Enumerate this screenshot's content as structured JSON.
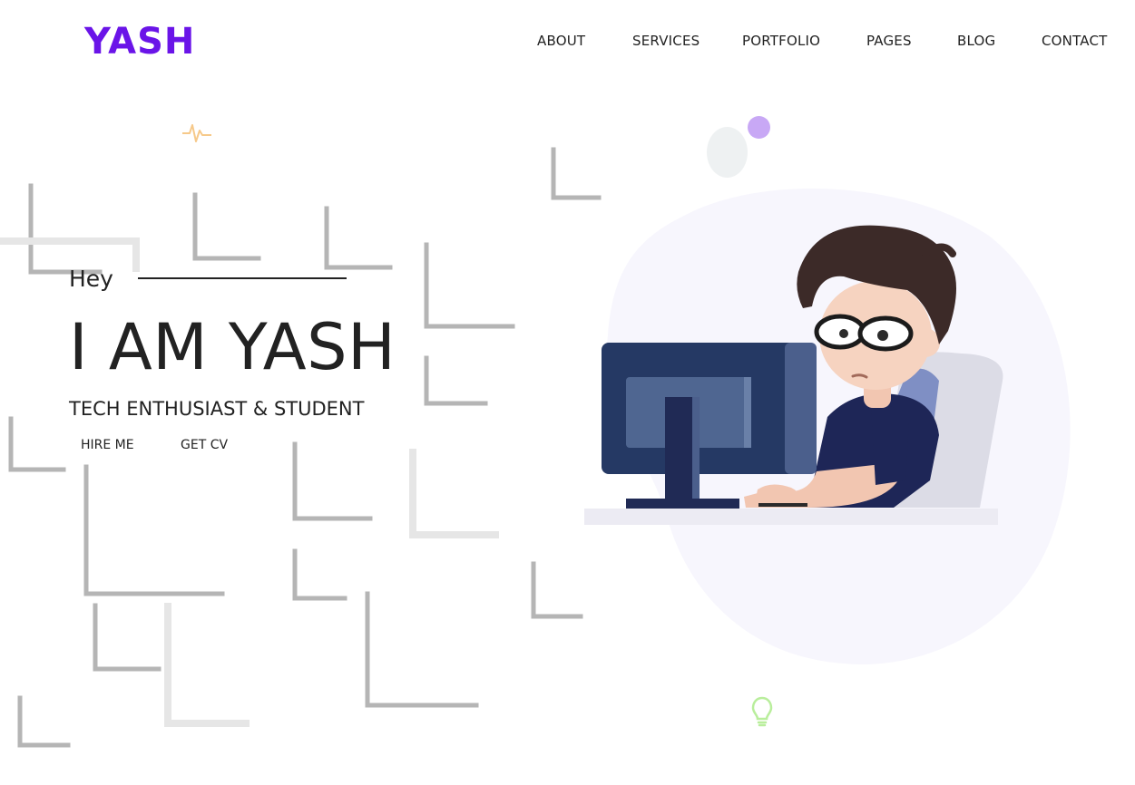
{
  "brand": {
    "logo_text": "YASH",
    "accent_color": "#6a14e8"
  },
  "nav": {
    "items": [
      "ABOUT",
      "SERVICES",
      "PORTFOLIO",
      "PAGES",
      "BLOG",
      "CONTACT"
    ]
  },
  "hero": {
    "greeting": "Hey",
    "headline": "I AM YASH",
    "tagline": "TECH ENTHUSIAST & STUDENT",
    "hire_button": "HIRE ME",
    "cv_button": "GET CV"
  },
  "icons": [
    "pulse-icon",
    "lightbulb-icon",
    "developer-illustration"
  ]
}
